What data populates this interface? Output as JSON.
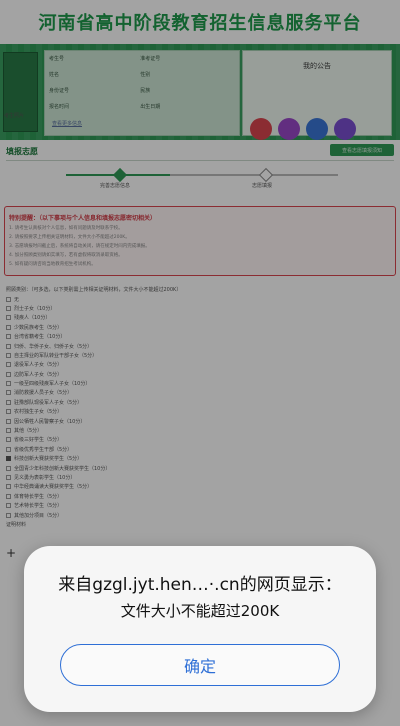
{
  "site": {
    "title": "河南省高中阶段教育招生信息服务平台"
  },
  "profile": {
    "photo_text": "",
    "photo_caption": "考生照片",
    "rows": [
      {
        "l1": "考生号",
        "v1": "",
        "l2": "准考证号",
        "v2": ""
      },
      {
        "l1": "姓名",
        "v1": "",
        "l2": "性别",
        "v2": ""
      },
      {
        "l1": "身份证号",
        "v1": "",
        "l2": "民族",
        "v2": ""
      },
      {
        "l1": "报名时间",
        "v1": "",
        "l2": "出生日期",
        "v2": ""
      }
    ],
    "link": "查看更多信息"
  },
  "notice": {
    "title": "我的公告"
  },
  "shortcuts": [
    {
      "label": "",
      "color": "#d9454f"
    },
    {
      "label": "",
      "color": "#9a49c9"
    },
    {
      "label": "",
      "color": "#3b76d6"
    },
    {
      "label": "",
      "color": "#7a4fd0"
    }
  ],
  "section": {
    "title": "填报志愿",
    "action": "查看志愿填报须知"
  },
  "steps": [
    {
      "label": "完善志愿信息",
      "state": "done"
    },
    {
      "label": "志愿填报",
      "state": "todo"
    }
  ],
  "warning": {
    "title": "特别提醒：（以下事项与个人信息和填报志愿密切相关）",
    "lines": [
      "1. 请考生认真核对个人信息，如有问题请及时联系学校。",
      "2. 请按照要求上传相关证明材料，文件大小不能超过200K。",
      "3. 志愿填报时间截止后，系统将自动关闭，请在规定时间内完成填报。",
      "4. 加分照顾类别请如实填写，若有虚假将取消录取资格。",
      "5. 如有疑问请咨询当地教育招生考试机构。"
    ]
  },
  "list": {
    "header": "照顾类别：（可多选，以下类别需上传相关证明材料，文件大小不能超过200K）",
    "items": [
      {
        "text": "无",
        "checked": false
      },
      {
        "text": "烈士子女（10分）",
        "checked": false
      },
      {
        "text": "残疾人（10分）",
        "checked": false
      },
      {
        "text": "少数民族考生（5分）",
        "checked": false
      },
      {
        "text": "台湾省籍考生（10分）",
        "checked": false
      },
      {
        "text": "归侨、华侨子女、归侨子女（5分）",
        "checked": false
      },
      {
        "text": "自主择业的军队转业干部子女（5分）",
        "checked": false
      },
      {
        "text": "退役军人子女（5分）",
        "checked": false
      },
      {
        "text": "边防军人子女（5分）",
        "checked": false
      },
      {
        "text": "一级至四级残疾军人子女（10分）",
        "checked": false
      },
      {
        "text": "消防救援人员子女（5分）",
        "checked": false
      },
      {
        "text": "驻豫部队现役军人子女（5分）",
        "checked": false
      },
      {
        "text": "农村独生子女（5分）",
        "checked": false
      },
      {
        "text": "因公牺牲人民警察子女（10分）",
        "checked": false
      },
      {
        "text": "其他（5分）",
        "checked": false
      },
      {
        "text": "省级三好学生（5分）",
        "checked": false
      },
      {
        "text": "省级优秀学生干部（5分）",
        "checked": false
      },
      {
        "text": "科技创新大赛获奖学生（5分）",
        "checked": true
      },
      {
        "text": "全国青少年科技创新大赛获奖学生（10分）",
        "checked": false
      },
      {
        "text": "见义勇为表彰学生（10分）",
        "checked": false
      },
      {
        "text": "中华经典诵读大赛获奖学生（5分）",
        "checked": false
      },
      {
        "text": "体育特长学生（5分）",
        "checked": false
      },
      {
        "text": "艺术特长学生（5分）",
        "checked": false
      },
      {
        "text": "其他加分项目（5分）",
        "checked": false
      }
    ],
    "footer": "证明材料"
  },
  "dialog": {
    "source": "来自gzgl.jyt.hen…·.cn的网页显示：",
    "message": "文件大小不能超过200K",
    "ok": "确定"
  },
  "colors": {
    "accent": "#2f9a57",
    "dialog_button": "#2e6fd6",
    "warning": "#d9454f"
  }
}
